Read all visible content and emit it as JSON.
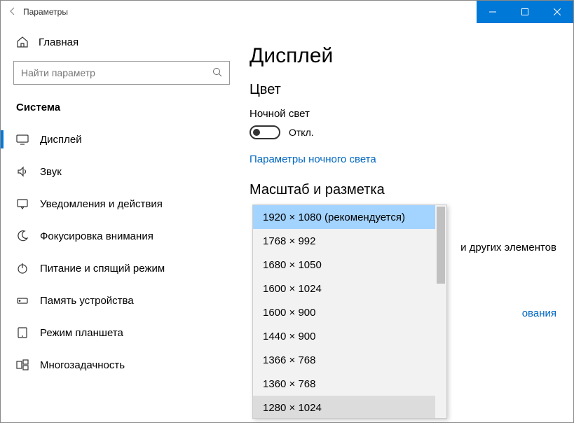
{
  "titlebar": {
    "title": "Параметры"
  },
  "sidebar": {
    "home": "Главная",
    "search_placeholder": "Найти параметр",
    "group": "Система",
    "items": [
      {
        "label": "Дисплей"
      },
      {
        "label": "Звук"
      },
      {
        "label": "Уведомления и действия"
      },
      {
        "label": "Фокусировка внимания"
      },
      {
        "label": "Питание и спящий режим"
      },
      {
        "label": "Память устройства"
      },
      {
        "label": "Режим планшета"
      },
      {
        "label": "Многозадачность"
      }
    ]
  },
  "main": {
    "title": "Дисплей",
    "section_color": "Цвет",
    "night_light_label": "Ночной свет",
    "toggle_state": "Откл.",
    "night_light_link": "Параметры ночного света",
    "section_scale": "Масштаб и разметка",
    "truncated_text": "и других элементов",
    "truncated_link": "ования"
  },
  "dropdown": {
    "items": [
      "1920 × 1080 (рекомендуется)",
      "1768 × 992",
      "1680 × 1050",
      "1600 × 1024",
      "1600 × 900",
      "1440 × 900",
      "1366 × 768",
      "1360 × 768",
      "1280 × 1024"
    ],
    "selected_index": 0,
    "hover_index": 8
  }
}
